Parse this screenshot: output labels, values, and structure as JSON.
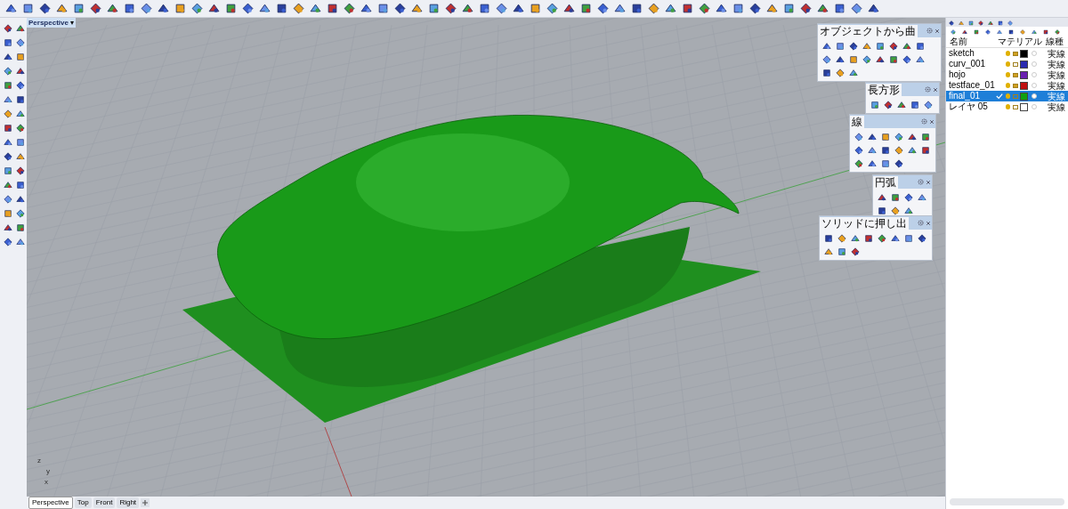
{
  "viewport": {
    "title": "Perspective",
    "menu_caret": "▾",
    "axis_labels": [
      "z",
      "y",
      "x"
    ]
  },
  "floating_toolbars": [
    {
      "title": "オブジェクトから曲"
    },
    {
      "title": "長方形"
    },
    {
      "title": "線"
    },
    {
      "title": "円弧"
    },
    {
      "title": "ソリッドに押し出"
    }
  ],
  "layers": {
    "columns": [
      "名前",
      "マテリアル",
      "線種"
    ],
    "rows": [
      {
        "name": "sketch",
        "selected": false,
        "current": false,
        "locked": true,
        "color": "#000000",
        "linetype": "実線"
      },
      {
        "name": "curv_001",
        "selected": false,
        "current": false,
        "locked": false,
        "color": "#2b2bb0",
        "linetype": "実線"
      },
      {
        "name": "hojo",
        "selected": false,
        "current": false,
        "locked": true,
        "color": "#6a1fb0",
        "linetype": "実線"
      },
      {
        "name": "testface_01",
        "selected": false,
        "current": false,
        "locked": true,
        "color": "#c01010",
        "linetype": "実線"
      },
      {
        "name": "final_01",
        "selected": true,
        "current": true,
        "locked": false,
        "color": "#10a010",
        "linetype": "実線"
      },
      {
        "name": "レイヤ 05",
        "selected": false,
        "current": false,
        "locked": false,
        "color": "#ffffff",
        "linetype": "実線"
      }
    ]
  },
  "view_tabs": [
    {
      "label": "Perspective",
      "selected": true
    },
    {
      "label": "Top",
      "selected": false
    },
    {
      "label": "Front",
      "selected": false
    },
    {
      "label": "Right",
      "selected": false
    }
  ]
}
